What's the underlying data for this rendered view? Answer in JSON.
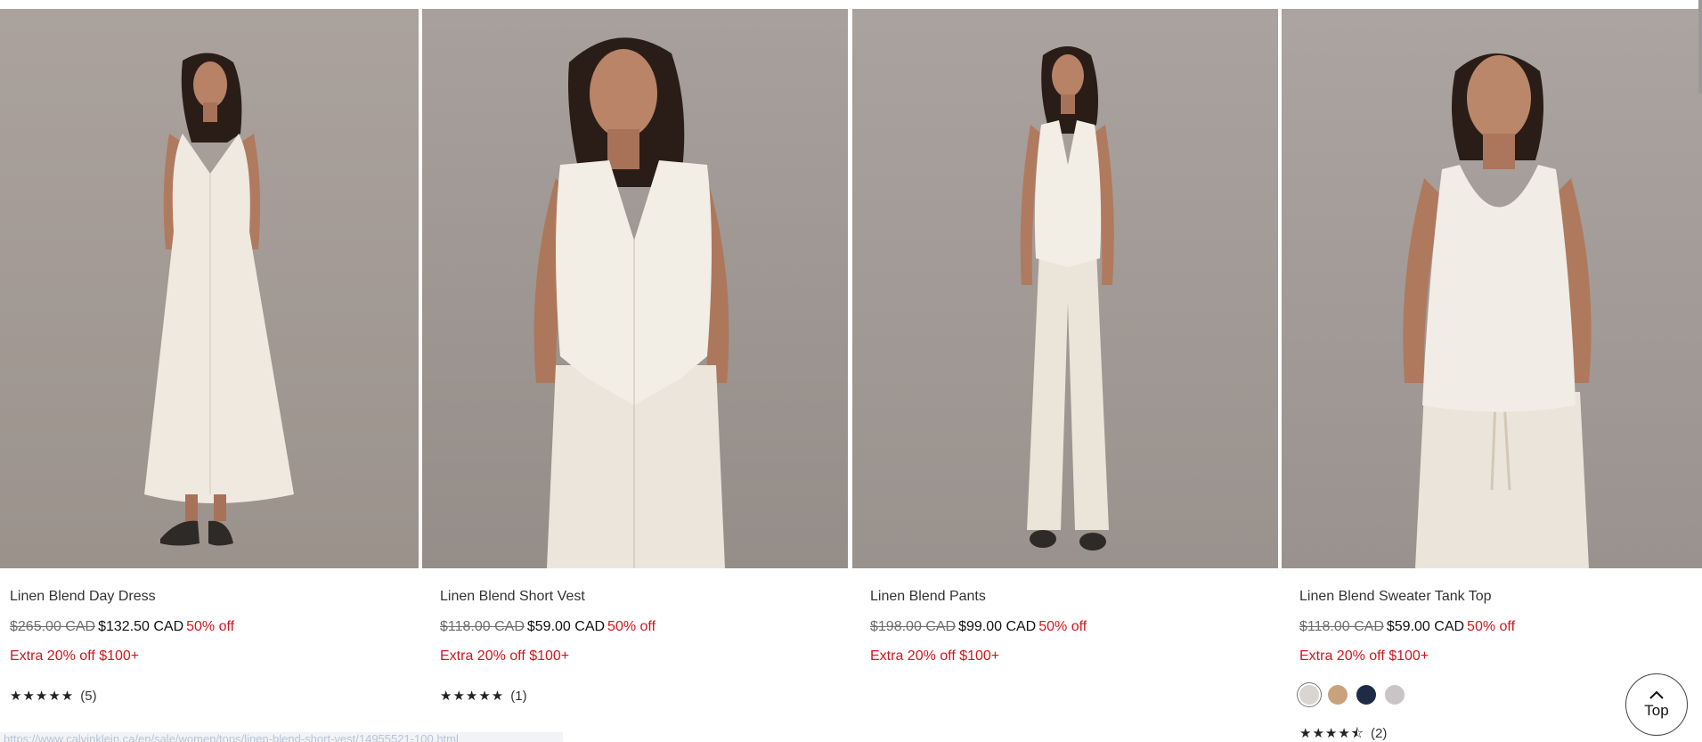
{
  "products": [
    {
      "name": "Linen Blend Day Dress",
      "price_original": "$265.00 CAD",
      "price_sale": "$132.50 CAD",
      "discount": "50% off",
      "promo": "Extra 20% off $100+",
      "stars": "★★★★★",
      "review_count": "(5)",
      "image": "woman in white sleeveless v-neck linen maxi dress with black mules"
    },
    {
      "name": "Linen Blend Short Vest",
      "price_original": "$118.00 CAD",
      "price_sale": "$59.00 CAD",
      "discount": "50% off",
      "promo": "Extra 20% off $100+",
      "stars": "★★★★★",
      "review_count": "(1)",
      "image": "woman in white linen vest and white trousers, cropped at thigh"
    },
    {
      "name": "Linen Blend Pants",
      "price_original": "$198.00 CAD",
      "price_sale": "$99.00 CAD",
      "discount": "50% off",
      "promo": "Extra 20% off $100+",
      "image": "woman in white linen vest and wide-leg linen pants, full length"
    },
    {
      "name": "Linen Blend Sweater Tank Top",
      "price_original": "$118.00 CAD",
      "price_sale": "$59.00 CAD",
      "discount": "50% off",
      "promo": "Extra 20% off $100+",
      "stars": "★★★★⯪",
      "review_count": "(2)",
      "swatches": [
        "#d9d6d1",
        "#c8a27c",
        "#1f2b45",
        "#c9c5c6"
      ],
      "image": "woman in white knit tank top and drawstring linen pants"
    }
  ],
  "top_button": {
    "label": "Top"
  },
  "status_bar": {
    "url": "https://www.calvinklein.ca/en/sale/women/tops/linen-blend-short-vest/14955521-100.html"
  },
  "colors": {
    "sale_red": "#d0161e",
    "background": "#ffffff"
  }
}
